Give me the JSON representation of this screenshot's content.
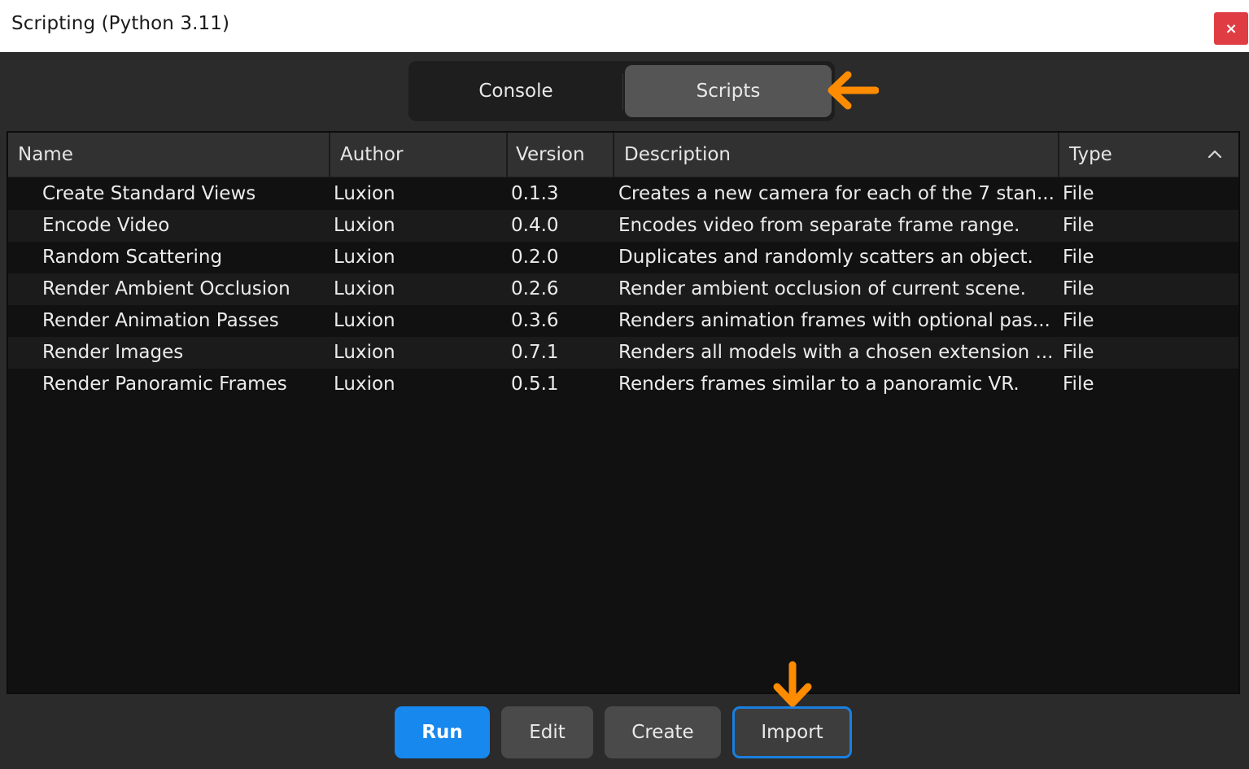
{
  "window": {
    "title": "Scripting (Python 3.11)",
    "close_label": "×"
  },
  "tabs": [
    {
      "label": "Console",
      "active": false
    },
    {
      "label": "Scripts",
      "active": true
    }
  ],
  "table": {
    "columns": [
      "Name",
      "Author",
      "Version",
      "Description",
      "Type"
    ],
    "rows": [
      {
        "name": "Create Standard Views",
        "author": "Luxion",
        "version": "0.1.3",
        "description": "Creates a new camera for each of the 7 stan...",
        "type": "File"
      },
      {
        "name": "Encode Video",
        "author": "Luxion",
        "version": "0.4.0",
        "description": "Encodes video from separate frame range.",
        "type": "File"
      },
      {
        "name": "Random Scattering",
        "author": "Luxion",
        "version": "0.2.0",
        "description": "Duplicates and randomly scatters an object.",
        "type": "File"
      },
      {
        "name": "Render Ambient Occlusion",
        "author": "Luxion",
        "version": "0.2.6",
        "description": "Render ambient occlusion of current scene.",
        "type": "File"
      },
      {
        "name": "Render Animation Passes",
        "author": "Luxion",
        "version": "0.3.6",
        "description": "Renders animation frames with optional pas...",
        "type": "File"
      },
      {
        "name": "Render Images",
        "author": "Luxion",
        "version": "0.7.1",
        "description": "Renders all models with a chosen extension ...",
        "type": "File"
      },
      {
        "name": "Render Panoramic Frames",
        "author": "Luxion",
        "version": "0.5.1",
        "description": "Renders frames similar to a panoramic VR.",
        "type": "File"
      }
    ]
  },
  "buttons": {
    "run": "Run",
    "edit": "Edit",
    "create": "Create",
    "import": "Import"
  },
  "colors": {
    "accent": "#1688ee",
    "annotation_arrow": "#ff8c00",
    "close": "#e03c44"
  },
  "icons": {
    "sort": "chevron-up-icon",
    "annotation_left": "arrow-left-icon",
    "annotation_down": "arrow-down-icon"
  }
}
